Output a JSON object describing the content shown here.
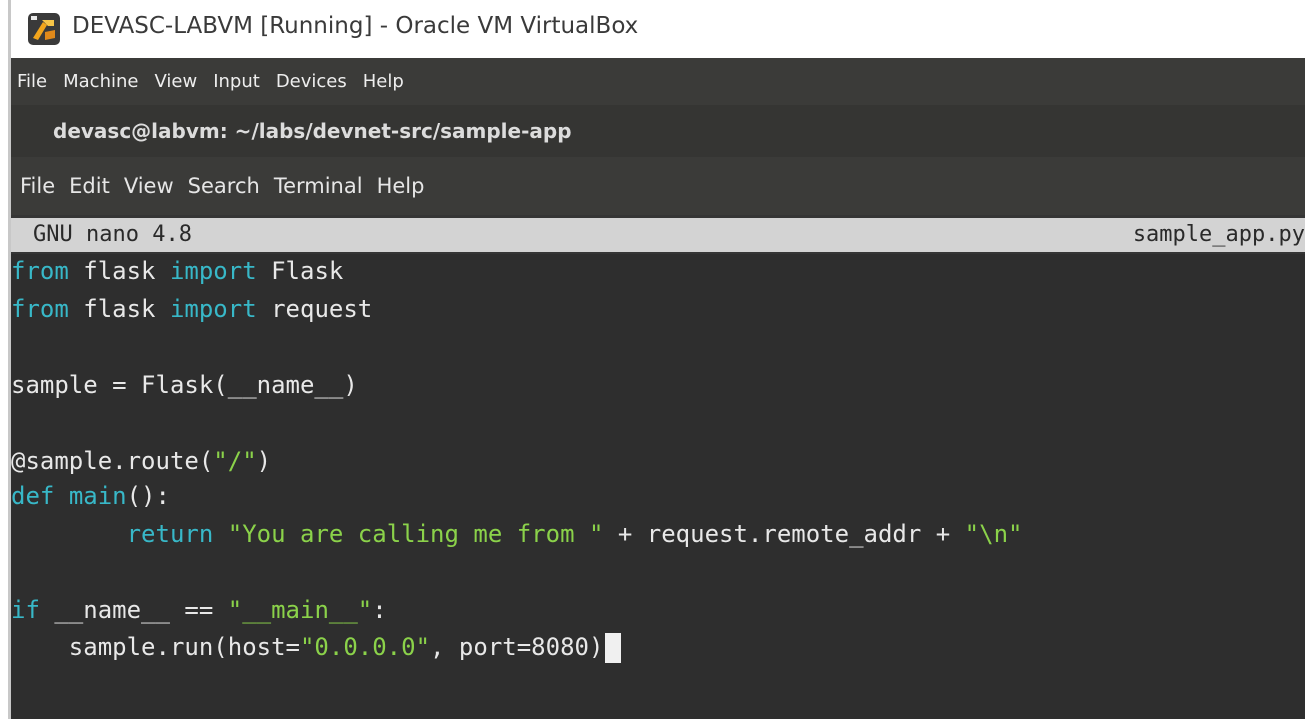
{
  "window": {
    "title": "DEVASC-LABVM [Running] - Oracle VM VirtualBox",
    "logo_icon": "virtualbox-logo-icon"
  },
  "vbox_menu": [
    "File",
    "Machine",
    "View",
    "Input",
    "Devices",
    "Help"
  ],
  "terminal": {
    "title": "devasc@labvm: ~/labs/devnet-src/sample-app",
    "menu": [
      "File",
      "Edit",
      "View",
      "Search",
      "Terminal",
      "Help"
    ]
  },
  "nano": {
    "version": "GNU nano 4.8",
    "filename": "sample_app.py"
  },
  "code": {
    "l1": {
      "a": "from",
      "b": " flask ",
      "c": "import",
      "d": " Flask"
    },
    "l2": {
      "a": "from",
      "b": " flask ",
      "c": "import",
      "d": " request"
    },
    "l4": "sample = Flask(__name__)",
    "l6": {
      "a": "@sample.route(",
      "b": "\"/\"",
      "c": ")"
    },
    "l7": {
      "a": "def",
      "b": " ",
      "c": "main",
      "d": "():"
    },
    "l8": {
      "indent": "        ",
      "a": "return",
      "b": " ",
      "c": "\"You are calling me from \"",
      "d": " + request.remote_addr + ",
      "e": "\"\\n\""
    },
    "l10": {
      "a": "if",
      "b": " __name__ == ",
      "c": "\"__main__\"",
      "d": ":"
    },
    "l11": {
      "indent": "    ",
      "a": "sample.run(host=",
      "b": "\"0.0.0.0\"",
      "c": ", port=8080)"
    }
  },
  "colors": {
    "keyword": "#38b8c8",
    "string": "#8bd24a",
    "background": "#2e2e2e",
    "nano_header": "#d3d3d3"
  }
}
